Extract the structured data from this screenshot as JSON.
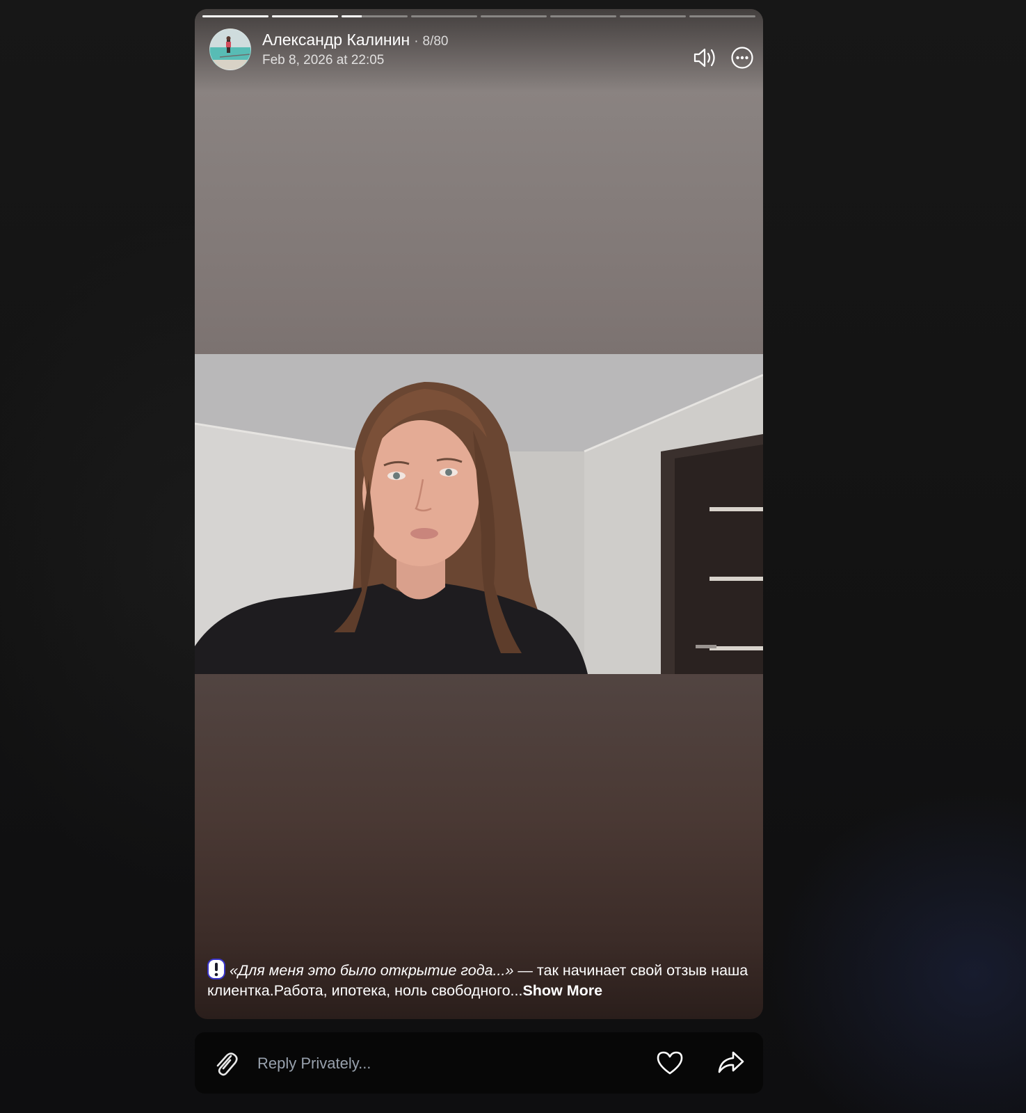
{
  "story": {
    "author": "Александр Калинин",
    "counter": "8/80",
    "date": "Feb 8, 2026 at 22:05",
    "progress": {
      "segments": 8,
      "completed": 2,
      "current_fraction": 0.3
    },
    "caption": {
      "quote": "«Для меня это было открытие года...»",
      "text": " — так начинает свой отзыв наша клиентка.Работа, ипотека, ноль свободного...",
      "show_more": "Show More"
    },
    "icons": {
      "volume": "volume-icon",
      "more": "more-options-icon",
      "caption": "exclamation-icon"
    }
  },
  "reply": {
    "placeholder": "Reply Privately...",
    "icons": {
      "attach": "paperclip-icon",
      "like": "heart-icon",
      "share": "share-icon"
    }
  },
  "colors": {
    "accent_caption_icon": "#3a35c9",
    "text": "#ffffff",
    "placeholder": "#98a1ad"
  }
}
